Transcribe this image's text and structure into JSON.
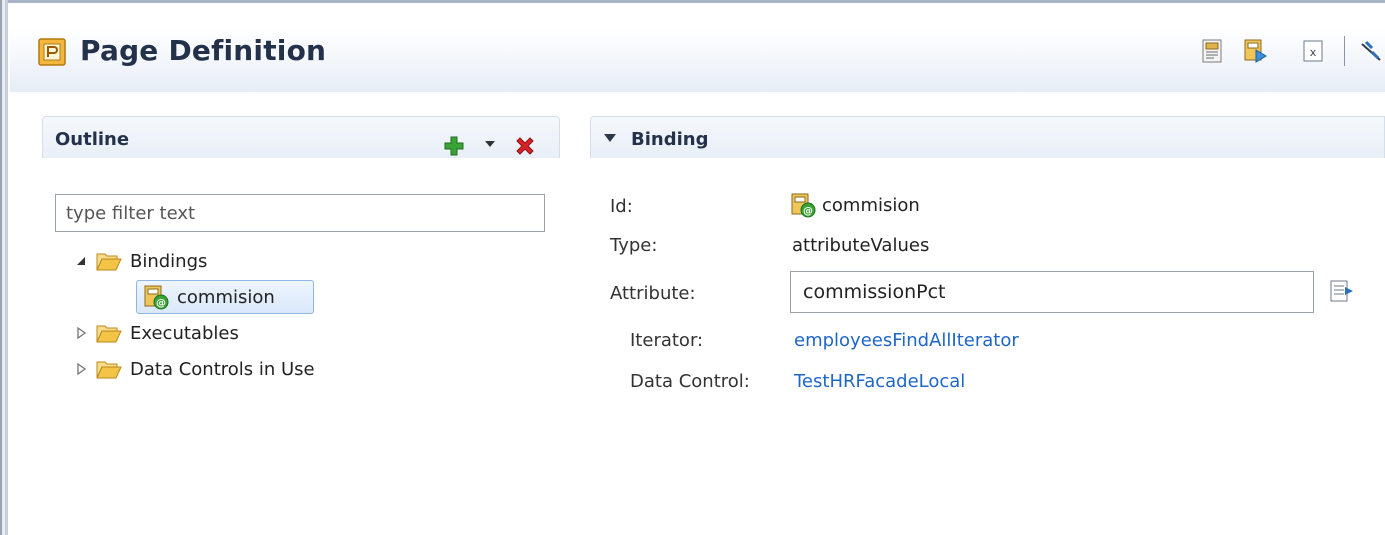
{
  "editor": {
    "title": "Page Definition",
    "toolbar": [
      {
        "name": "page-source-icon"
      },
      {
        "name": "run-page-icon"
      },
      {
        "name": "xml-source-icon"
      },
      {
        "name": "unlink-icon"
      }
    ]
  },
  "outline": {
    "title": "Outline",
    "filter_placeholder": "type filter text",
    "tree": [
      {
        "label": "Bindings",
        "expanded": true,
        "children": [
          {
            "label": "commision",
            "selected": true
          }
        ]
      },
      {
        "label": "Executables",
        "expanded": false
      },
      {
        "label": "Data Controls in Use",
        "expanded": false
      }
    ]
  },
  "binding": {
    "title": "Binding",
    "id_label": "Id:",
    "id_value": "commision",
    "type_label": "Type:",
    "type_value": "attributeValues",
    "attribute_label": "Attribute:",
    "attribute_value": "commissionPct",
    "iterator_label": "Iterator:",
    "iterator_value": "employeesFindAllIterator",
    "data_control_label": "Data Control:",
    "data_control_value": "TestHRFacadeLocal"
  },
  "colors": {
    "link": "#1f66c9",
    "header_text": "#23324a",
    "add_green": "#3aa335",
    "delete_red": "#d9232b",
    "folder_yellow": "#f2c447"
  }
}
